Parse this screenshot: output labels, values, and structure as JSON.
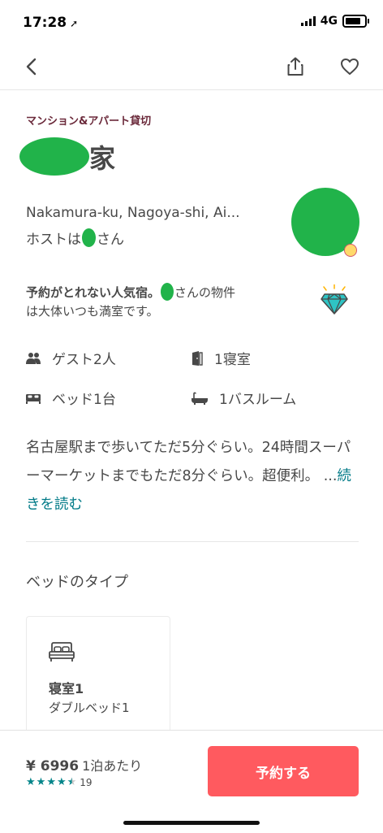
{
  "status_bar": {
    "time": "17:28",
    "network": "4G"
  },
  "listing": {
    "category": "マンション&アパート貸切",
    "title_suffix": "家",
    "location": "Nakamura-ku, Nagoya-shi, Ai...",
    "host_prefix": "ホストは",
    "host_suffix": "さん"
  },
  "popularity": {
    "bold": "予約がとれない人気宿。",
    "rest": "さんの物件",
    "line2": "は大体いつも満室です。"
  },
  "amenities": {
    "guests": "ゲスト2人",
    "bedrooms": "1寝室",
    "beds": "ベッド1台",
    "bathrooms": "1バスルーム"
  },
  "description": {
    "text": "名古屋駅まで歩いてただ5分ぐらい。24時間スーパーマーケットまでもただ8分ぐらい。超便利。 ...",
    "read_more": "続きを読む"
  },
  "bed_types": {
    "heading": "ベッドのタイプ",
    "rooms": [
      {
        "name": "寝室1",
        "bed": "ダブルベッド1"
      }
    ]
  },
  "booking": {
    "price": "¥ 6996",
    "per_night": "1泊あたり",
    "rating_stars": 4.5,
    "review_count": "19",
    "reserve_label": "予約する"
  },
  "colors": {
    "accent": "#ff5a5f",
    "link": "#007a87",
    "star": "#008489",
    "redaction": "#21b34a"
  }
}
